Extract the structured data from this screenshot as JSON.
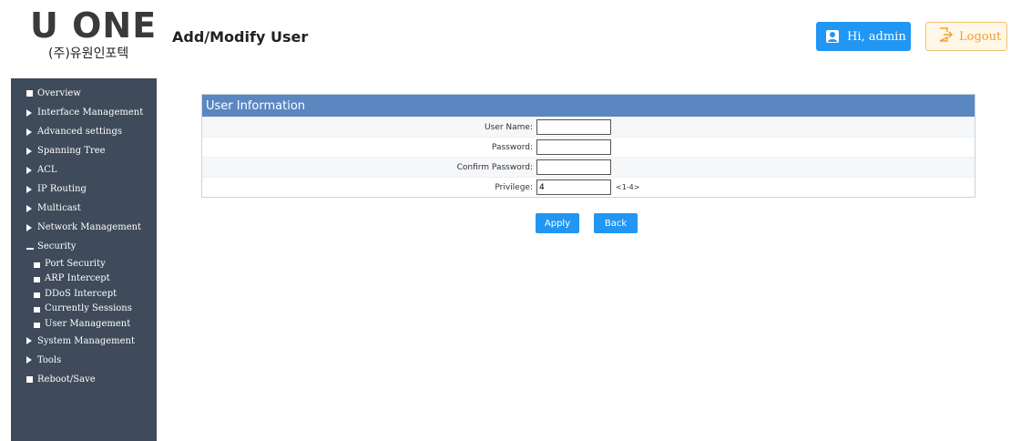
{
  "header": {
    "logo_text": "U ONE",
    "logo_subtext": "(주)유원인포텍",
    "page_title": "Add/Modify User",
    "user_label": "Hi, admin",
    "logout_label": "Logout"
  },
  "sidebar": {
    "items": [
      {
        "label": "Overview",
        "icon": "square-icon"
      },
      {
        "label": "Interface Management",
        "icon": "triangle-right-icon"
      },
      {
        "label": "Advanced settings",
        "icon": "triangle-right-icon"
      },
      {
        "label": "Spanning Tree",
        "icon": "triangle-right-icon"
      },
      {
        "label": "ACL",
        "icon": "triangle-right-icon"
      },
      {
        "label": "IP Routing",
        "icon": "triangle-right-icon"
      },
      {
        "label": "Multicast",
        "icon": "triangle-right-icon"
      },
      {
        "label": "Network Management",
        "icon": "triangle-right-icon"
      },
      {
        "label": "Security",
        "icon": "minus-icon"
      },
      {
        "label": "System Management",
        "icon": "triangle-right-icon"
      },
      {
        "label": "Tools",
        "icon": "triangle-right-icon"
      },
      {
        "label": "Reboot/Save",
        "icon": "square-icon"
      }
    ],
    "security_subitems": [
      "Port Security",
      "ARP Intercept",
      "DDoS Intercept",
      "Currently Sessions",
      "User Management"
    ]
  },
  "form": {
    "title": "User Information",
    "fields": [
      {
        "label": "User Name:",
        "value": ""
      },
      {
        "label": "Password:",
        "value": ""
      },
      {
        "label": "Confirm Password:",
        "value": ""
      },
      {
        "label": "Privilege:",
        "value": "4",
        "hint": "<1-4>"
      }
    ],
    "apply_label": "Apply",
    "back_label": "Back"
  },
  "colors": {
    "sidebar_bg": "#3f4a5a",
    "panel_header": "#5b87c1",
    "primary_button": "#2196f3",
    "logout_accent": "#f0a030"
  }
}
